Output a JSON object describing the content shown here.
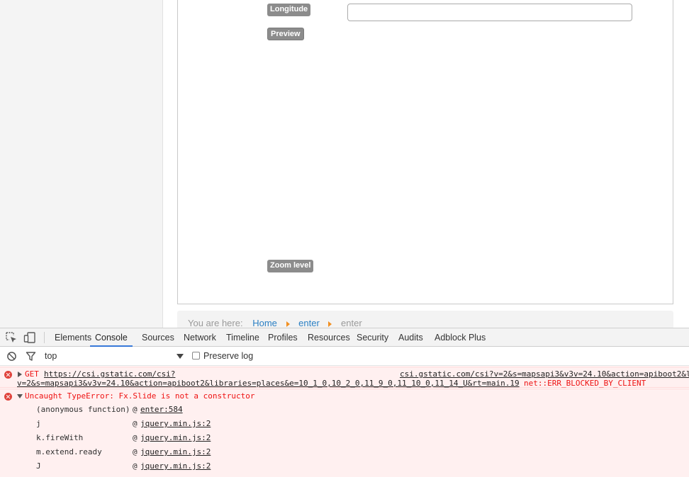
{
  "page": {
    "longitude_label": "Longitude",
    "longitude_value": "",
    "preview_label": "Preview",
    "zoom_label": "Zoom level",
    "breadcrumb": {
      "prefix": "You are here:",
      "home": "Home",
      "item1": "enter",
      "item2": "enter"
    }
  },
  "devtools": {
    "tabs": [
      "Elements",
      "Console",
      "Sources",
      "Network",
      "Timeline",
      "Profiles",
      "Resources",
      "Security",
      "Audits",
      "Adblock Plus"
    ],
    "active_tab": "Console",
    "context": "top",
    "preserve_log_label": "Preserve log",
    "preserve_log_checked": false,
    "accent_color": "#3879d9"
  },
  "console": {
    "error1": {
      "method": "GET",
      "url_line1": "https://csi.gstatic.com/csi?",
      "url_line2": "v=2&s=mapsapi3&v3v=24.10&action=apiboot2&libraries=places&e=10_1_0,10_2_0,11_9_0,11_10_0,11_14_U&rt=main.19",
      "source": "csi.gstatic.com/csi?v=2&s=mapsapi3&v3v=24.10&action=apiboot2&l",
      "status": "net::ERR_BLOCKED_BY_CLIENT"
    },
    "error2": {
      "message": "Uncaught TypeError: Fx.Slide is not a constructor",
      "stack": [
        {
          "fn": "(anonymous function)",
          "at": "@",
          "loc": "enter:584"
        },
        {
          "fn": "j",
          "at": "@",
          "loc": "jquery.min.js:2"
        },
        {
          "fn": "k.fireWith",
          "at": "@",
          "loc": "jquery.min.js:2"
        },
        {
          "fn": "m.extend.ready",
          "at": "@",
          "loc": "jquery.min.js:2"
        },
        {
          "fn": "J",
          "at": "@",
          "loc": "jquery.min.js:2"
        }
      ]
    },
    "error_color": "#e11111"
  }
}
